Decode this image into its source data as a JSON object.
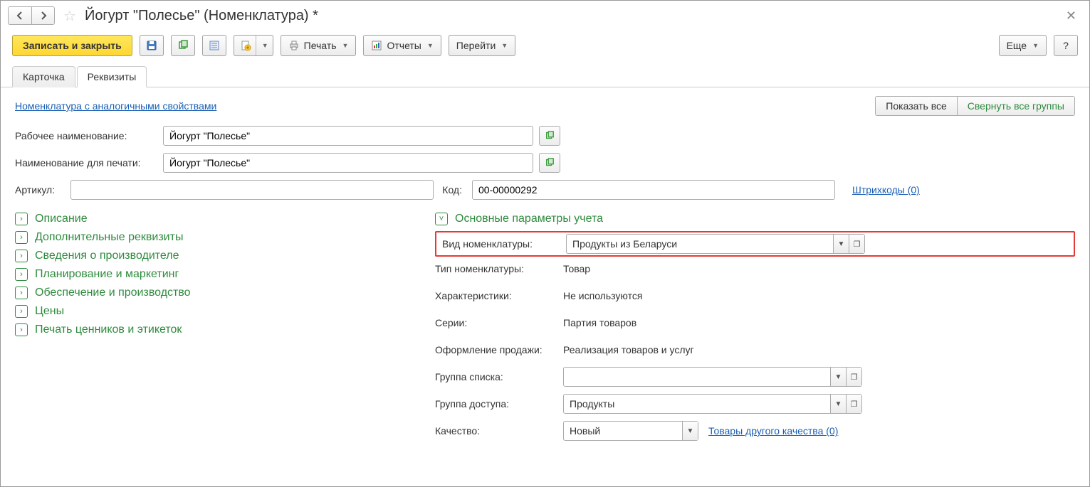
{
  "titlebar": {
    "title": "Йогурт \"Полесье\" (Номенклатура) *"
  },
  "toolbar": {
    "save_close": "Записать и закрыть",
    "print": "Печать",
    "reports": "Отчеты",
    "goto": "Перейти",
    "more": "Еще",
    "help": "?"
  },
  "tabs": {
    "card": "Карточка",
    "requisites": "Реквизиты"
  },
  "toprow": {
    "similar_link": "Номенклатура с аналогичными свойствами",
    "show_all": "Показать все",
    "collapse_all": "Свернуть все группы"
  },
  "fields": {
    "working_name_label": "Рабочее наименование:",
    "working_name_value": "Йогурт \"Полесье\"",
    "print_name_label": "Наименование для печати:",
    "print_name_value": "Йогурт \"Полесье\"",
    "article_label": "Артикул:",
    "article_value": "",
    "code_label": "Код:",
    "code_value": "00-00000292",
    "barcodes_link": "Штрихкоды (0)"
  },
  "left_groups": {
    "g1": "Описание",
    "g2": "Дополнительные реквизиты",
    "g3": "Сведения о производителе",
    "g4": "Планирование и маркетинг",
    "g5": "Обеспечение и производство",
    "g6": "Цены",
    "g7": "Печать ценников и этикеток"
  },
  "right": {
    "main_params_title": "Основные параметры учета",
    "kind_label": "Вид номенклатуры:",
    "kind_value": "Продукты из Беларуси",
    "type_label": "Тип номенклатуры:",
    "type_value": "Товар",
    "char_label": "Характеристики:",
    "char_value": "Не используются",
    "series_label": "Серии:",
    "series_value": "Партия товаров",
    "sale_label": "Оформление продажи:",
    "sale_value": "Реализация товаров и услуг",
    "list_group_label": "Группа списка:",
    "list_group_value": "",
    "access_group_label": "Группа доступа:",
    "access_group_value": "Продукты",
    "quality_label": "Качество:",
    "quality_value": "Новый",
    "other_quality_link": "Товары другого качества (0)"
  }
}
